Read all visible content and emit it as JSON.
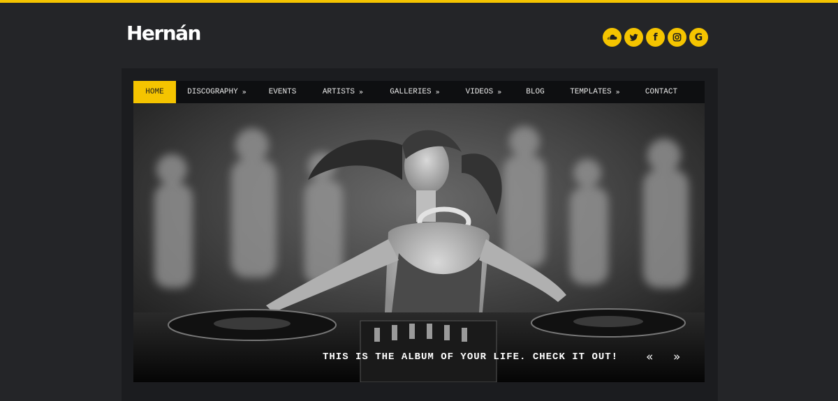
{
  "site": {
    "logo": "Hernán"
  },
  "social": [
    {
      "name": "soundcloud",
      "icon": "soundcloud-icon"
    },
    {
      "name": "twitter",
      "icon": "twitter-icon"
    },
    {
      "name": "facebook",
      "icon": "facebook-icon",
      "glyph": "f"
    },
    {
      "name": "instagram",
      "icon": "instagram-icon"
    },
    {
      "name": "google",
      "icon": "google-icon",
      "glyph": "G"
    }
  ],
  "nav": {
    "items": [
      {
        "label": "HOME",
        "active": true,
        "submenu": false
      },
      {
        "label": "DISCOGRAPHY",
        "active": false,
        "submenu": true
      },
      {
        "label": "EVENTS",
        "active": false,
        "submenu": false
      },
      {
        "label": "ARTISTS",
        "active": false,
        "submenu": true
      },
      {
        "label": "GALLERIES",
        "active": false,
        "submenu": true
      },
      {
        "label": "VIDEOS",
        "active": false,
        "submenu": true
      },
      {
        "label": "BLOG",
        "active": false,
        "submenu": false
      },
      {
        "label": "TEMPLATES",
        "active": false,
        "submenu": true
      },
      {
        "label": "CONTACT",
        "active": false,
        "submenu": false
      }
    ],
    "submenu_glyph": "»"
  },
  "hero": {
    "caption": "THIS IS THE ALBUM OF YOUR LIFE. CHECK IT OUT!",
    "prev": "«",
    "next": "»"
  },
  "colors": {
    "accent": "#f5c400",
    "background": "#242528",
    "panel": "#1b1c1f",
    "nav": "#0e0f11"
  }
}
